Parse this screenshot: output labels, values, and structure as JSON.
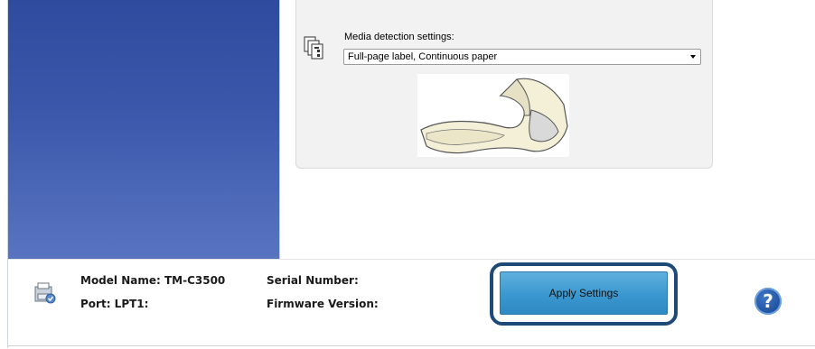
{
  "media_settings": {
    "label": "Media detection settings:",
    "selected_value": "Full-page label, Continuous paper",
    "icon": "media-detection-icon"
  },
  "illustration": {
    "name": "continuous-paper-illustration"
  },
  "status": {
    "model_name_label": "Model Name: TM-C3500",
    "port_label": "Port: LPT1:",
    "serial_number_label": "Serial Number:",
    "firmware_version_label": "Firmware Version:",
    "printer_icon": "printer-icon"
  },
  "actions": {
    "apply_label": "Apply Settings",
    "help_label": "?"
  },
  "colors": {
    "sidebar_top": "#2f4b9e",
    "sidebar_bottom": "#5874c1",
    "apply_button": "#3a97cf",
    "highlight_border": "#1e4a78",
    "help_button": "#1f4f9c"
  }
}
